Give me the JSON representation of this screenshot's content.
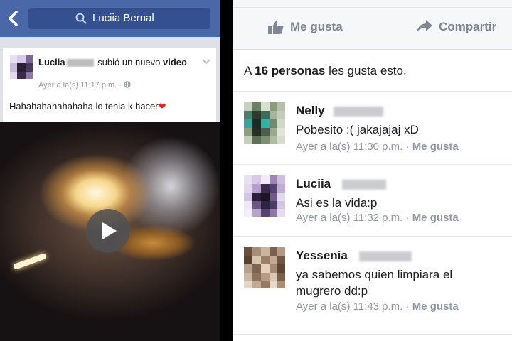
{
  "left": {
    "search": {
      "query": "Luciia Bernal"
    },
    "post": {
      "author_first": "Luciia",
      "action_text": "subió un nuevo",
      "action_object": "video",
      "action_suffix": ".",
      "time": "Ayer a la(s) 11:17 p.m. ·",
      "caption": "Hahahahahahahaha lo tenia k hacer",
      "caption_emoji": "❤"
    }
  },
  "right": {
    "actions": {
      "like_label": "Me gusta",
      "share_label": "Compartir"
    },
    "likes": {
      "prefix": "A ",
      "count_text": "16 personas",
      "suffix": " les gusta esto."
    },
    "comments": [
      {
        "name": "Nelly",
        "text": "Pobesito :( jakajajaj xD",
        "time": "Ayer a la(s) 11:30 p.m. · ",
        "like": "Me gusta"
      },
      {
        "name": "Luciia",
        "text": "Asi es la vida:p",
        "time": "Ayer a la(s) 11:32 p.m. · ",
        "like": "Me gusta"
      },
      {
        "name": "Yessenia",
        "text": "ya sabemos quien limpiara el mugrero dd:p",
        "time": "Ayer a la(s) 11:43 p.m. · ",
        "like": "Me gusta"
      }
    ]
  },
  "colors": {
    "header_blue": "#4a67a8",
    "meta_gray": "#9197a3",
    "heart": "#e0262b"
  },
  "icons": [
    "back-arrow-icon",
    "search-icon",
    "chevron-down-icon",
    "globe-icon",
    "play-icon",
    "thumbs-up-icon",
    "share-arrow-icon",
    "heart-icon"
  ]
}
